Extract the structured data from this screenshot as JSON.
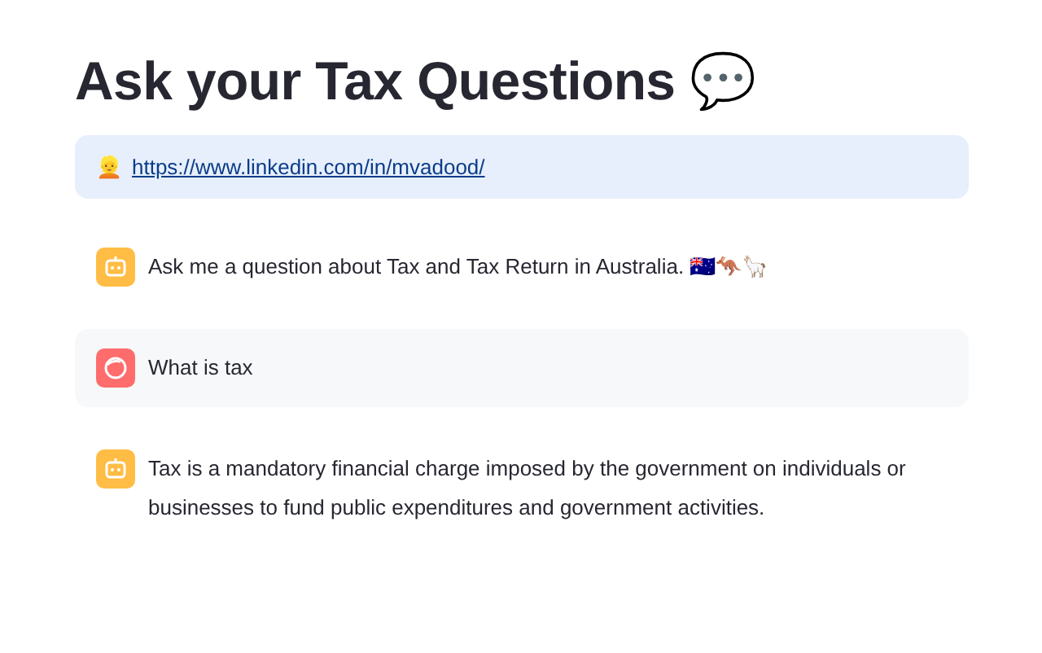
{
  "title": "Ask your Tax Questions 💬",
  "info": {
    "emoji": "👱",
    "link": "https://www.linkedin.com/in/mvadood/"
  },
  "messages": [
    {
      "kind": "assistant",
      "text": "Ask me a question about Tax and Tax Return in Australia. 🇦🇺🦘🦙"
    },
    {
      "kind": "user",
      "text": "What is tax"
    },
    {
      "kind": "assistant",
      "text": "Tax is a mandatory financial charge imposed by the government on individuals or businesses to fund public expenditures and government activities."
    }
  ]
}
